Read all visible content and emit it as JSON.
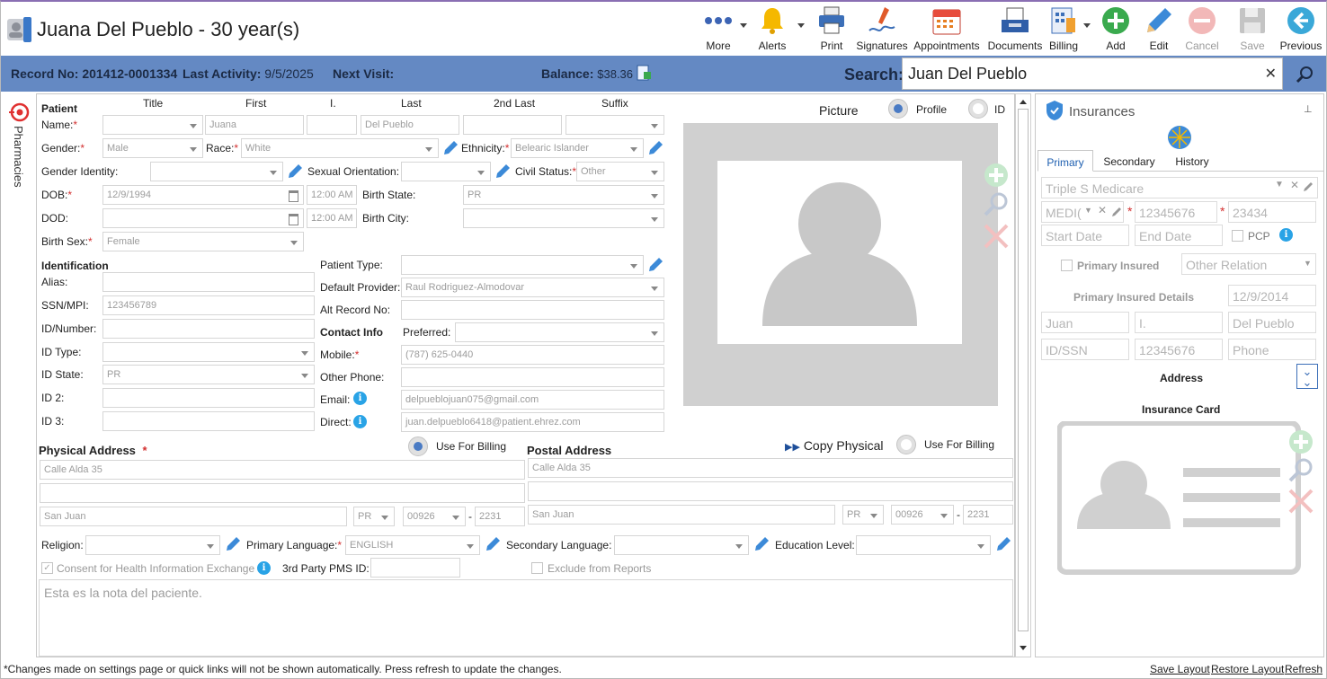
{
  "header": {
    "title": "Juana Del Pueblo - 30 year(s)",
    "toolbar": [
      {
        "id": "more",
        "label": "More",
        "icon": "more-dots-icon",
        "dropdown": true
      },
      {
        "id": "alerts",
        "label": "Alerts",
        "icon": "bell-icon",
        "dropdown": true
      },
      {
        "id": "print",
        "label": "Print",
        "icon": "printer-icon"
      },
      {
        "id": "signatures",
        "label": "Signatures",
        "icon": "signature-pen-icon"
      },
      {
        "id": "appointments",
        "label": "Appointments",
        "icon": "calendar-icon"
      },
      {
        "id": "documents",
        "label": "Documents",
        "icon": "documents-tray-icon"
      },
      {
        "id": "billing",
        "label": "Billing",
        "icon": "billing-icon",
        "dropdown": true
      },
      {
        "id": "add",
        "label": "Add",
        "icon": "plus-circle-icon"
      },
      {
        "id": "edit",
        "label": "Edit",
        "icon": "pencil-icon"
      },
      {
        "id": "cancel",
        "label": "Cancel",
        "icon": "cancel-circle-icon",
        "disabled": true
      },
      {
        "id": "save",
        "label": "Save",
        "icon": "floppy-disk-icon",
        "disabled": true
      },
      {
        "id": "previous",
        "label": "Previous",
        "icon": "arrow-left-circle-icon"
      }
    ]
  },
  "infobar": {
    "record_label": "Record No:",
    "record_value": "201412-0001334",
    "activity_label": "Last Activity:",
    "activity_value": "9/5/2025",
    "next_label": "Next Visit:",
    "balance_label": "Balance:",
    "balance_value": "$38.36",
    "search_label": "Search:",
    "search_value": "Juan Del Pueblo"
  },
  "sidebar": {
    "pharmacies_label": "Pharmacies"
  },
  "patient": {
    "section": "Patient",
    "cols": {
      "title": "Title",
      "first": "First",
      "initial": "I.",
      "last": "Last",
      "second_last": "2nd Last",
      "suffix": "Suffix"
    },
    "name_label": "Name:",
    "first": "Juana",
    "last": "Del Pueblo",
    "gender_label": "Gender:",
    "gender": "Male",
    "race_label": "Race:",
    "race": "White",
    "ethnicity_label": "Ethnicity:",
    "ethnicity": "Belearic Islander",
    "gender_identity_label": "Gender Identity:",
    "sexual_orientation_label": "Sexual Orientation:",
    "civil_status_label": "Civil Status:",
    "civil_status": "Other",
    "dob_label": "DOB:",
    "dob": "12/9/1994",
    "dob_time": "12:00 AM",
    "birth_state_label": "Birth State:",
    "birth_state": "PR",
    "dod_label": "DOD:",
    "dod_time": "12:00 AM",
    "birth_city_label": "Birth City:",
    "birth_sex_label": "Birth Sex:",
    "birth_sex": "Female"
  },
  "identification": {
    "section": "Identification",
    "alias_label": "Alias:",
    "ssn_label": "SSN/MPI:",
    "ssn": "123456789",
    "idnum_label": "ID/Number:",
    "idtype_label": "ID Type:",
    "idstate_label": "ID State:",
    "idstate": "PR",
    "id2_label": "ID 2:",
    "id3_label": "ID 3:",
    "patient_type_label": "Patient Type:",
    "default_provider_label": "Default Provider:",
    "default_provider": "Raul Rodriguez-Almodovar",
    "alt_record_label": "Alt Record No:"
  },
  "contact": {
    "section": "Contact Info",
    "preferred_label": "Preferred:",
    "mobile_label": "Mobile:",
    "mobile": "(787) 625-0440",
    "other_phone_label": "Other Phone:",
    "email_label": "Email:",
    "email": "delpueblojuan075@gmail.com",
    "direct_label": "Direct:",
    "direct": "juan.delpueblo6418@patient.ehrez.com"
  },
  "picture": {
    "label": "Picture",
    "profile_label": "Profile",
    "id_label": "ID"
  },
  "physical": {
    "section": "Physical Address",
    "use_billing_label": "Use For Billing",
    "line1": "Calle Alda 35",
    "city": "San Juan",
    "state": "PR",
    "zip": "00926",
    "zip4": "2231"
  },
  "postal": {
    "section": "Postal Address",
    "copy_label": "Copy Physical",
    "use_billing_label": "Use For Billing",
    "line1": "Calle Alda 35",
    "city": "San Juan",
    "state": "PR",
    "zip": "00926",
    "zip4": "2231"
  },
  "misc": {
    "religion_label": "Religion:",
    "primary_language_label": "Primary Language:",
    "primary_language": "ENGLISH",
    "secondary_language_label": "Secondary Language:",
    "education_label": "Education Level:",
    "consent_label": "Consent for Health Information Exchange",
    "pms_label": "3rd Party PMS ID:",
    "exclude_label": "Exclude from Reports",
    "dash": "-",
    "note": "Esta es la nota del paciente."
  },
  "insurances": {
    "title": "Insurances",
    "tabs": [
      "Primary",
      "Secondary",
      "History"
    ],
    "plan": "Triple S Medicare",
    "type": "MEDI(",
    "member_id": "12345676",
    "group": "23434",
    "start_placeholder": "Start Date",
    "end_placeholder": "End Date",
    "pcp_label": "PCP",
    "primary_insured_label": "Primary Insured",
    "other_relation": "Other Relation",
    "details_label": "Primary Insured Details",
    "details_date": "12/9/2014",
    "ins_first": "Juan",
    "ins_initial": "I.",
    "ins_last": "Del Pueblo",
    "idssn_placeholder": "ID/SSN",
    "ins_id": "12345676",
    "phone_placeholder": "Phone",
    "address_label": "Address",
    "card_label": "Insurance Card"
  },
  "footer": {
    "note": "*Changes made on settings page or quick links will not be shown automatically. Press refresh to update the changes.",
    "save_layout": "Save Layout",
    "restore_layout": "Restore Layout",
    "refresh": "Refresh"
  }
}
